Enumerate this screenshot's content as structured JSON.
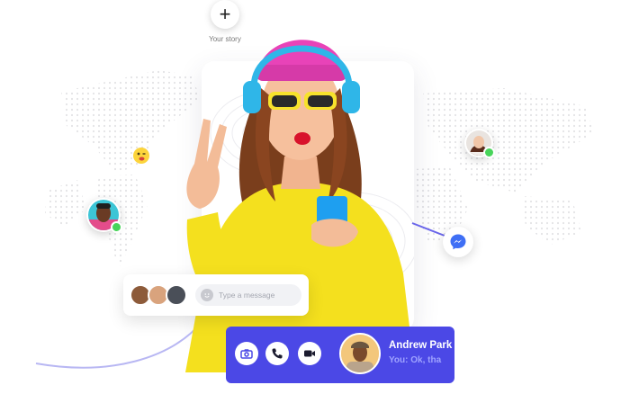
{
  "story": {
    "add_icon": "+",
    "label": "Your story"
  },
  "compose": {
    "placeholder": "Type a message"
  },
  "call": {
    "caller_name": "Andrew Park",
    "last_message": "You: Ok, tha",
    "actions": [
      "camera-icon",
      "phone-icon",
      "video-icon"
    ]
  },
  "colors": {
    "accent": "#4b48e6",
    "online": "#48d45a",
    "messenger": "#3f6ff5",
    "sweater": "#f4e01e",
    "beanie": "#e843b8",
    "headphones": "#2fb6e8"
  }
}
